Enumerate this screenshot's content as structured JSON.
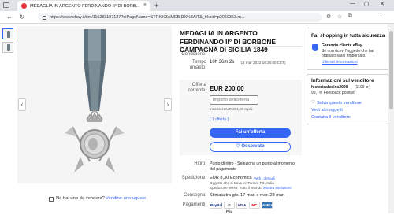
{
  "browser": {
    "tab_title": "MEDAGLIA IN ARGENTO FERDINANDO II° DI BORB...",
    "url": "https://www.ebay.it/itm/115283197127?oiPageName=STRK%3AMEBIDX%3AIT&_trksid=p2060353.m...",
    "new_tab_symbol": "+",
    "tab_close_symbol": "×",
    "back_symbol": "←",
    "refresh_symbol": "↻",
    "min_symbol": "—",
    "max_symbol": "▢",
    "close_symbol": "✕",
    "ext_symbols": [
      "⚙",
      "☆",
      "⧉",
      "…"
    ]
  },
  "viewer": {
    "prev_symbol": "‹",
    "next_symbol": "›"
  },
  "listing": {
    "title": "MEDAGLIA IN ARGENTO FERDINANDO II° DI BORBONE CAMPAGNA DI SICILIA 1849",
    "condition_label": "Condizione:",
    "condition_value": "--",
    "time_label": "Tempo rimasto:",
    "time_value": "10h 36m 2s",
    "time_end": "(14 mar 2022  16:36:00 CET)",
    "offer_label": "Offerta corrente:",
    "price": "EUR 200,00",
    "offer_placeholder": "Importo dell'offerta",
    "offer_hint": "Inserisci EUR 201,00 o più",
    "offer_count": "[ 1 offerta ]",
    "bid_button": "Fai un'offerta",
    "watch_button": "Osservato",
    "pickup_label": "Ritiro:",
    "pickup_value": "Punto di ritiro - Seleziona un punto al momento del pagamento",
    "shipping_label": "Spedizione:",
    "shipping_value": "EUR 8,30",
    "shipping_service": "Economica",
    "shipping_details": "Vedi i dettagli",
    "shipping_location": "Oggetto che si trova in: Torino, TO, Italia",
    "shipping_to": "Spedizione verso: Tutto il mondo",
    "shipping_more": "Mostra esclusioni",
    "delivery_label": "Consegna:",
    "delivery_value": "Stimata tra gio. 17 mar. e mer. 23 mar.",
    "payments_label": "Pagamenti:",
    "payments": [
      "PayPal",
      "G Pay",
      "VISA",
      "MC",
      "AMEX"
    ]
  },
  "bottom": {
    "question": "Ne hai uno da vendere?",
    "sell_link": "Vendine uno uguale"
  },
  "shop": {
    "title": "Fai shopping in tutta sicurezza",
    "guarantee_title": "Garanzia cliente eBay",
    "guarantee_text": "Se non ricevi l'oggetto che hai ordinato sarai rimborsato.",
    "more_link": "Ulteriori informazioni"
  },
  "seller": {
    "title": "Informazioni sul venditore",
    "name": "historicalcoins2000",
    "score": "(1109 ★)",
    "feedback": "99,7% Feedback positivo",
    "save_link": "Salva questo venditore",
    "other_link": "Vedi altri oggetti",
    "contact_link": "Contatta il venditore",
    "heart_symbol": "♡"
  },
  "colors": {
    "accent": "#3665f3",
    "ebay_red": "#e53238"
  }
}
